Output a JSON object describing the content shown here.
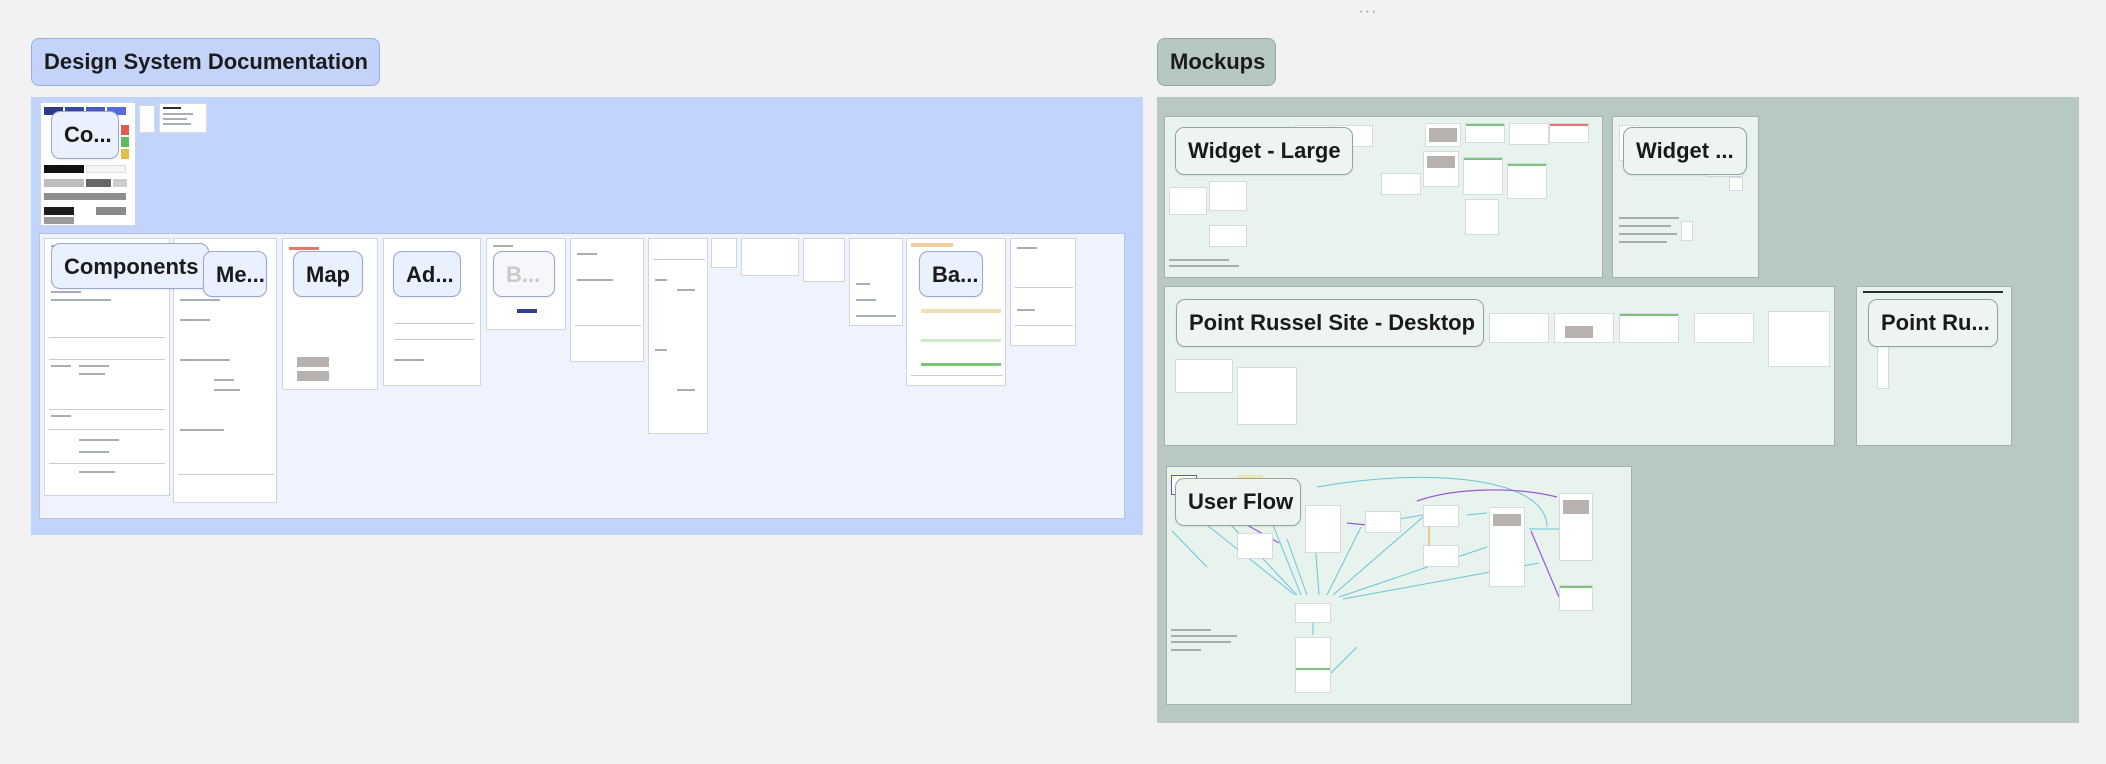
{
  "toolbar": {
    "more_icon": "more-horizontal-icon",
    "more_glyph": "···"
  },
  "sections": {
    "design_system": {
      "title": "Design System Documentation",
      "header_bg": "#c3d3fa",
      "area_bg": "#c1d4fb",
      "frames": [
        {
          "label": "Co..."
        },
        {
          "label": "Components"
        },
        {
          "label": "Me..."
        },
        {
          "label": "Map"
        },
        {
          "label": "Ad..."
        },
        {
          "label": "B..."
        },
        {
          "label": "Ba..."
        }
      ]
    },
    "mockups": {
      "title": "Mockups",
      "header_bg": "#b6c9c1",
      "area_bg": "#b7c9c2",
      "frames": [
        {
          "label": "Widget - Large"
        },
        {
          "label": "Widget ..."
        },
        {
          "label": "Point Russel Site - Desktop"
        },
        {
          "label": "Point Ru..."
        },
        {
          "label": "User Flow"
        }
      ]
    }
  },
  "colors": {
    "canvas": "#f2f2f2",
    "frame_green": "#e8f3ee",
    "frame_blue": "#eef3fd",
    "flow_cyan": "#67c5d8",
    "flow_purple": "#9b57d6"
  }
}
